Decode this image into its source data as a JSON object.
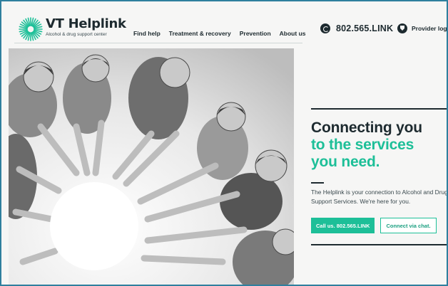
{
  "brand": {
    "name": "VT Helplink",
    "tagline": "Alcohol & drug support center",
    "accent": "#1dbf98",
    "dark": "#1d2a2f"
  },
  "nav": {
    "items": [
      {
        "label": "Find help"
      },
      {
        "label": "Treatment & recovery"
      },
      {
        "label": "Prevention"
      },
      {
        "label": "About us"
      }
    ]
  },
  "utility": {
    "phone_icon": "phone-icon",
    "phone": "802.565.LINK",
    "provider_icon": "shield-icon",
    "provider_label": "Provider login"
  },
  "hero": {
    "image": "group-of-people-hands-joined-in-circle",
    "headline_dark": "Connecting you",
    "headline_accent": "to the services you need.",
    "description": "The Helplink is your connection to Alcohol and Drug Support Services. We're here for you.",
    "primary_button": "Call us. 802.565.LINK",
    "secondary_button": "Connect via chat."
  }
}
